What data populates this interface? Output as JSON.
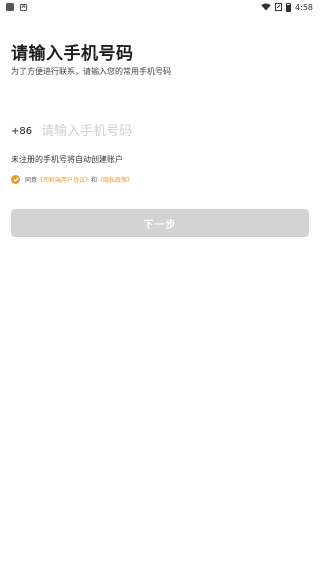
{
  "status_bar": {
    "time": "4:58"
  },
  "page": {
    "title": "请输入手机号码",
    "subtitle": "为了方便进行联系，请输入您的常用手机号码"
  },
  "phone": {
    "country_code": "+86",
    "placeholder": "请输入手机号码",
    "value": ""
  },
  "hint": "未注册的手机号将自动创建账户",
  "agreement": {
    "prefix": "同意",
    "link1": "《司机端用户协议》",
    "conj": "和",
    "link2": "《隐私政策》"
  },
  "next_button_label": "下一步",
  "colors": {
    "accent": "#e49b2f",
    "button_disabled": "#d3d3d3"
  },
  "icons": [
    "app-square-icon",
    "a-notification-icon",
    "wifi-icon",
    "cast-icon",
    "battery-icon",
    "checkmark-icon"
  ]
}
